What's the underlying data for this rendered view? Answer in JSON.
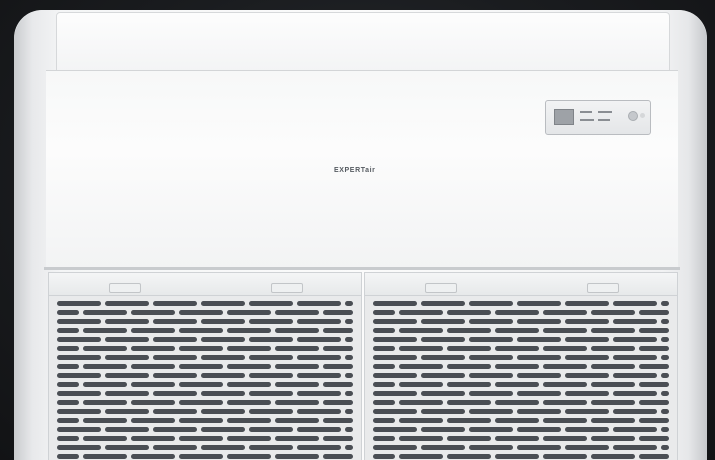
{
  "product": {
    "brand_logo": "EXPERTair",
    "type": "ceiling-floor air conditioner indoor unit"
  },
  "colors": {
    "background": "#1a1c1f",
    "body": "#f6f7f8",
    "grille_slot": "#4a4e54"
  },
  "display_panel": {
    "icon": "control-display-panel-icon"
  }
}
